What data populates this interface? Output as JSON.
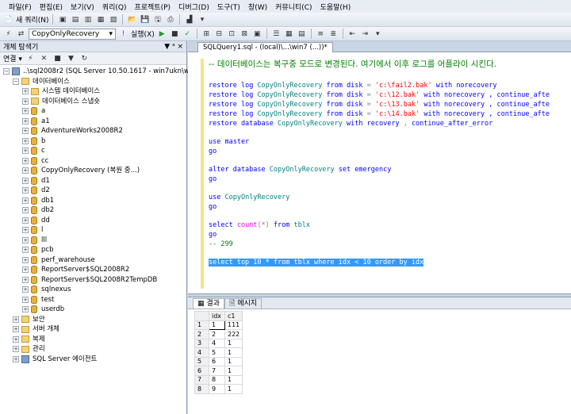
{
  "menu": [
    "파일(F)",
    "편집(E)",
    "보기(V)",
    "쿼리(Q)",
    "프로젝트(P)",
    "디버그(D)",
    "도구(T)",
    "창(W)",
    "커뮤니티(C)",
    "도움말(H)"
  ],
  "toolbar": {
    "new_query_label": "새 쿼리(N)",
    "database_select": "CopyOnlyRecovery",
    "execute_label": "실행(X)"
  },
  "object_explorer": {
    "title": "개체 탐색기",
    "pin": "▼ ᵃ ×",
    "connect_label": "연결 ▾",
    "server": "..\\sql2008r2 (SQL Server 10.50.1617 - win7ukn\\win7)",
    "databases_label": "데이터베이스",
    "system_db": "시스템 데이터베이스",
    "snapshots": "데이터베이스 스냅숏",
    "databases": [
      "a",
      "a1",
      "AdventureWorks2008R2",
      "b",
      "c",
      "cc",
      "CopyOnlyRecovery (복원 중...)",
      "d1",
      "d2",
      "db1",
      "db2",
      "dd",
      "l",
      "lll",
      "pcb",
      "perf_warehouse",
      "ReportServer$SQL2008R2",
      "ReportServer$SQL2008R2TempDB",
      "sqlnexus",
      "test",
      "userdb"
    ],
    "bottom_nodes": [
      "보안",
      "서버 개체",
      "복제",
      "관리",
      "SQL Server 에이전트"
    ]
  },
  "editor": {
    "tab_title": "SQLQuery1.sql - (local)\\...\\win7 (...))*",
    "comment": "-- 데이터베이스는 복구중 모드로 변경된다. 여기에서 이후 로그를 어플라이 시킨다.",
    "lines": {
      "r1": [
        "restore",
        "log",
        "CopyOnlyRecovery",
        "from",
        "disk",
        "=",
        "'c:\\fail2.bak'",
        "with",
        "norecovery",
        ""
      ],
      "r2": [
        "restore",
        "log",
        "CopyOnlyRecovery",
        "from",
        "disk",
        "=",
        "'c:\\12.bak'",
        "with",
        "norecovery",
        ", continue_afte"
      ],
      "r3": [
        "restore",
        "log",
        "CopyOnlyRecovery",
        "from",
        "disk",
        "=",
        "'c:\\13.bak'",
        "with",
        "norecovery",
        ", continue_afte"
      ],
      "r4": [
        "restore",
        "log",
        "CopyOnlyRecovery",
        "from",
        "disk",
        "=",
        "'c:\\14.bak'",
        "with",
        "norecovery",
        ", continue_afte"
      ],
      "r5": "restore database CopyOnlyRecovery with recovery , continue_after_error",
      "use_master": "use master",
      "go": "go",
      "alter": "alter database CopyOnlyRecovery set emergency",
      "use_db": "use CopyOnlyRecovery",
      "select_count": "select count(*) from tblx",
      "result_comment": "-- 299",
      "selected_query": "select top 10 * from tblx where idx < 10 order by idx"
    }
  },
  "results": {
    "tab_results": "결과",
    "tab_messages": "메시지",
    "columns": [
      "idx",
      "c1"
    ],
    "rows": [
      [
        "1",
        "1",
        "111"
      ],
      [
        "2",
        "2",
        "222"
      ],
      [
        "3",
        "4",
        "1"
      ],
      [
        "4",
        "5",
        "1"
      ],
      [
        "5",
        "6",
        "1"
      ],
      [
        "6",
        "7",
        "1"
      ],
      [
        "7",
        "8",
        "1"
      ],
      [
        "8",
        "9",
        "1"
      ]
    ]
  }
}
